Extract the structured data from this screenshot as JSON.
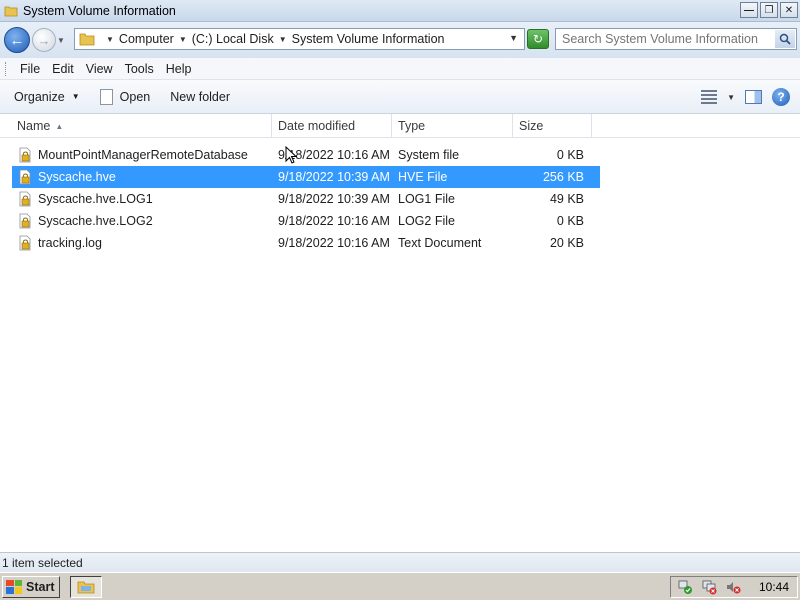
{
  "window": {
    "title": "System Volume Information",
    "controls": [
      "minimize",
      "maximize",
      "close"
    ]
  },
  "address": {
    "crumbs": [
      "Computer",
      "(C:) Local Disk",
      "System Volume Information"
    ],
    "search_placeholder": "Search System Volume Information"
  },
  "menu": {
    "items": [
      "File",
      "Edit",
      "View",
      "Tools",
      "Help"
    ]
  },
  "toolbar": {
    "organize": "Organize",
    "open": "Open",
    "new_folder": "New folder"
  },
  "columns": {
    "name": "Name",
    "date": "Date modified",
    "type": "Type",
    "size": "Size"
  },
  "files": [
    {
      "name": "MountPointManagerRemoteDatabase",
      "date": "9/18/2022 10:16 AM",
      "type": "System file",
      "size": "0 KB",
      "selected": false
    },
    {
      "name": "Syscache.hve",
      "date": "9/18/2022 10:39 AM",
      "type": "HVE File",
      "size": "256 KB",
      "selected": true
    },
    {
      "name": "Syscache.hve.LOG1",
      "date": "9/18/2022 10:39 AM",
      "type": "LOG1 File",
      "size": "49 KB",
      "selected": false
    },
    {
      "name": "Syscache.hve.LOG2",
      "date": "9/18/2022 10:16 AM",
      "type": "LOG2 File",
      "size": "0 KB",
      "selected": false
    },
    {
      "name": "tracking.log",
      "date": "9/18/2022 10:16 AM",
      "type": "Text Document",
      "size": "20 KB",
      "selected": false
    }
  ],
  "status": {
    "text": "1 item selected"
  },
  "taskbar": {
    "start": "Start",
    "clock": "10:44"
  },
  "colors": {
    "selection": "#3399ff",
    "accent": "#1e5cb6"
  }
}
